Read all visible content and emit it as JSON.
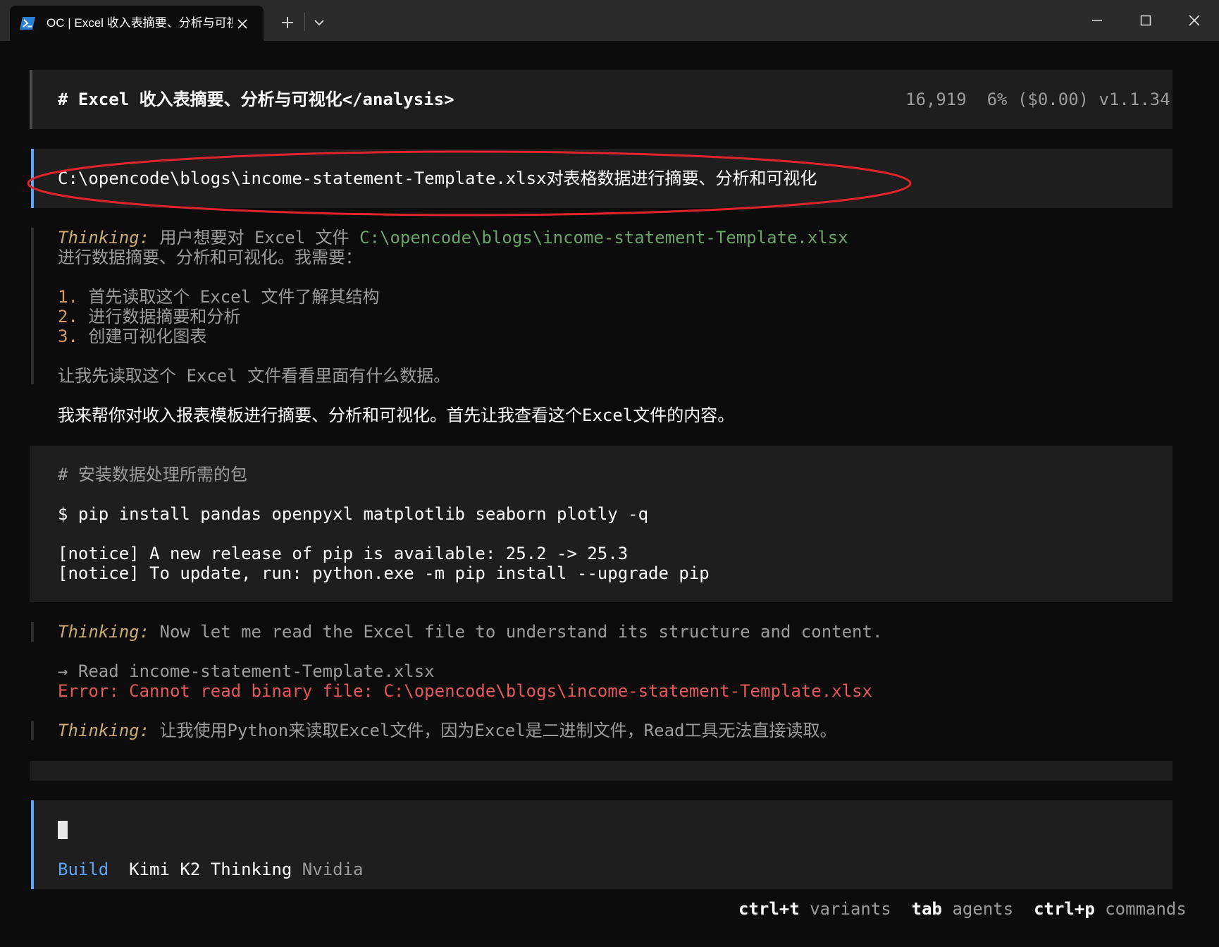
{
  "window": {
    "tab_title": "OC | Excel 收入表摘要、分析与可视化</analysis>",
    "new_tab_label": "+",
    "colors": {
      "titlebar": "#2b2b2b",
      "terminal_bg": "#0c0c0c",
      "panel": "#1e1e1e",
      "accent_blue": "#5fa3f5",
      "annotation_red": "#e0242c"
    }
  },
  "header": {
    "title": "# Excel 收入表摘要、分析与可视化</analysis>",
    "stats": "16,919  6% ($0.00) v1.1.34"
  },
  "prompt": {
    "text": "C:\\opencode\\blogs\\income-statement-Template.xlsx对表格数据进行摘要、分析和可视化"
  },
  "thinking1": {
    "label": "Thinking:",
    "text": " 用户想要对 Excel 文件 ",
    "path": "C:\\opencode\\blogs\\income-statement-Template.xlsx",
    "line2": "进行数据摘要、分析和可视化。我需要：",
    "steps": [
      {
        "num": "1.",
        "text": " 首先读取这个 Excel 文件了解其结构"
      },
      {
        "num": "2.",
        "text": " 进行数据摘要和分析"
      },
      {
        "num": "3.",
        "text": " 创建可视化图表"
      }
    ],
    "closing": "让我先读取这个 Excel 文件看看里面有什么数据。"
  },
  "reply1": "我来帮你对收入报表模板进行摘要、分析和可视化。首先让我查看这个Excel文件的内容。",
  "bash": {
    "comment": "# 安装数据处理所需的包",
    "command": "$ pip install pandas openpyxl matplotlib seaborn plotly -q",
    "output": [
      "[notice] A new release of pip is available: 25.2 -> 25.3",
      "[notice] To update, run: python.exe -m pip install --upgrade pip"
    ]
  },
  "thinking2": {
    "label": "Thinking:",
    "text": " Now let me read the Excel file to understand its structure and content."
  },
  "read_tool": {
    "line": "→ Read income-statement-Template.xlsx",
    "error": "Error: Cannot read binary file: C:\\opencode\\blogs\\income-statement-Template.xlsx"
  },
  "thinking3": {
    "label": "Thinking:",
    "text": " 让我使用Python来读取Excel文件，因为Excel是二进制文件，Read工具无法直接读取。"
  },
  "input": {
    "mode": "Build",
    "model": "Kimi K2 Thinking",
    "provider": "Nvidia"
  },
  "footer": {
    "hints": [
      {
        "key": "ctrl+t",
        "label": "variants"
      },
      {
        "key": "tab",
        "label": "agents"
      },
      {
        "key": "ctrl+p",
        "label": "commands"
      }
    ]
  }
}
